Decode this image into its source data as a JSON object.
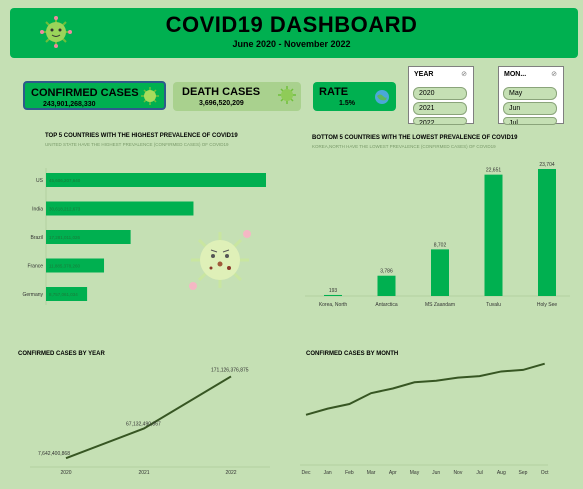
{
  "header": {
    "title": "COVID19 DASHBOARD",
    "subtitle": "June 2020 - November 2022"
  },
  "cards": {
    "confirmed_label": "CONFIRMED CASES",
    "confirmed_value": "243,901,268,330",
    "death_label": "DEATH CASES",
    "death_value": "3,696,520,209",
    "rate_label": "RATE",
    "rate_value": "1.5%"
  },
  "slicers": {
    "year_label": "YEAR",
    "year_items": [
      "2020",
      "2021",
      "2022"
    ],
    "month_label": "MON...",
    "month_items": [
      "May",
      "Jun",
      "Jul"
    ]
  },
  "top5": {
    "title": "TOP 5 COUNTRIES WITH  THE HIGHEST PREVALENCE OF COVID19",
    "subtitle": "UNITED STATE HAVE THE HIGHEST PREVALENCE (CONFIRMED CASES) OF COVID19"
  },
  "bottom5": {
    "title": "BOTTOM 5 COUNTRIES WITH  THE LOWEST PREVALENCE OF COVID19",
    "subtitle": "KOREA,NORTH HAVE THE LOWEST PREVALENCE (CONFIRMED CASES) OF COVID19"
  },
  "by_year": {
    "title": "CONFIRMED CASES BY YEAR"
  },
  "by_month": {
    "title": "CONFIRMED CASES BY MONTH"
  },
  "chart_data": [
    {
      "type": "bar",
      "orientation": "horizontal",
      "title": "TOP 5 COUNTRIES WITH  THE HIGHEST PREVALENCE OF COVID19",
      "categories": [
        "US",
        "India",
        "Brazil",
        "France",
        "Germany"
      ],
      "values": [
        45500000000,
        30500000000,
        17500000000,
        12000000000,
        8500000000
      ],
      "data_labels": [
        "45,606,207,640",
        "30,618,212,673",
        "17,281,011,026",
        "11,885,378,260",
        "8,757,061,034"
      ]
    },
    {
      "type": "bar",
      "title": "BOTTOM 5 COUNTRIES WITH  THE LOWEST PREVALENCE OF COVID19",
      "categories": [
        "Korea, North",
        "Antarctica",
        "MS Zaandam",
        "Tuvalu",
        "Holy See"
      ],
      "values": [
        193,
        3786,
        8702,
        22651,
        23704
      ],
      "data_labels": [
        "193",
        "3,786",
        "8,702",
        "22,651",
        "23,704"
      ]
    },
    {
      "type": "line",
      "title": "CONFIRMED CASES BY YEAR",
      "x": [
        "2020",
        "2021",
        "2022"
      ],
      "values": [
        7642400868,
        67132490867,
        171126376875
      ],
      "data_labels": [
        "7,642,400,868",
        "67,132,490,867",
        "171,126,376,875"
      ]
    },
    {
      "type": "line",
      "title": "CONFIRMED CASES BY MONTH",
      "x": [
        "Dec",
        "Jan",
        "Feb",
        "Mar",
        "Apr",
        "May",
        "Jun",
        "Nov",
        "Jul",
        "Aug",
        "Sep",
        "Oct"
      ],
      "values": [
        13,
        17,
        20,
        27,
        30,
        34,
        35,
        37,
        38,
        41,
        42,
        46
      ]
    }
  ]
}
